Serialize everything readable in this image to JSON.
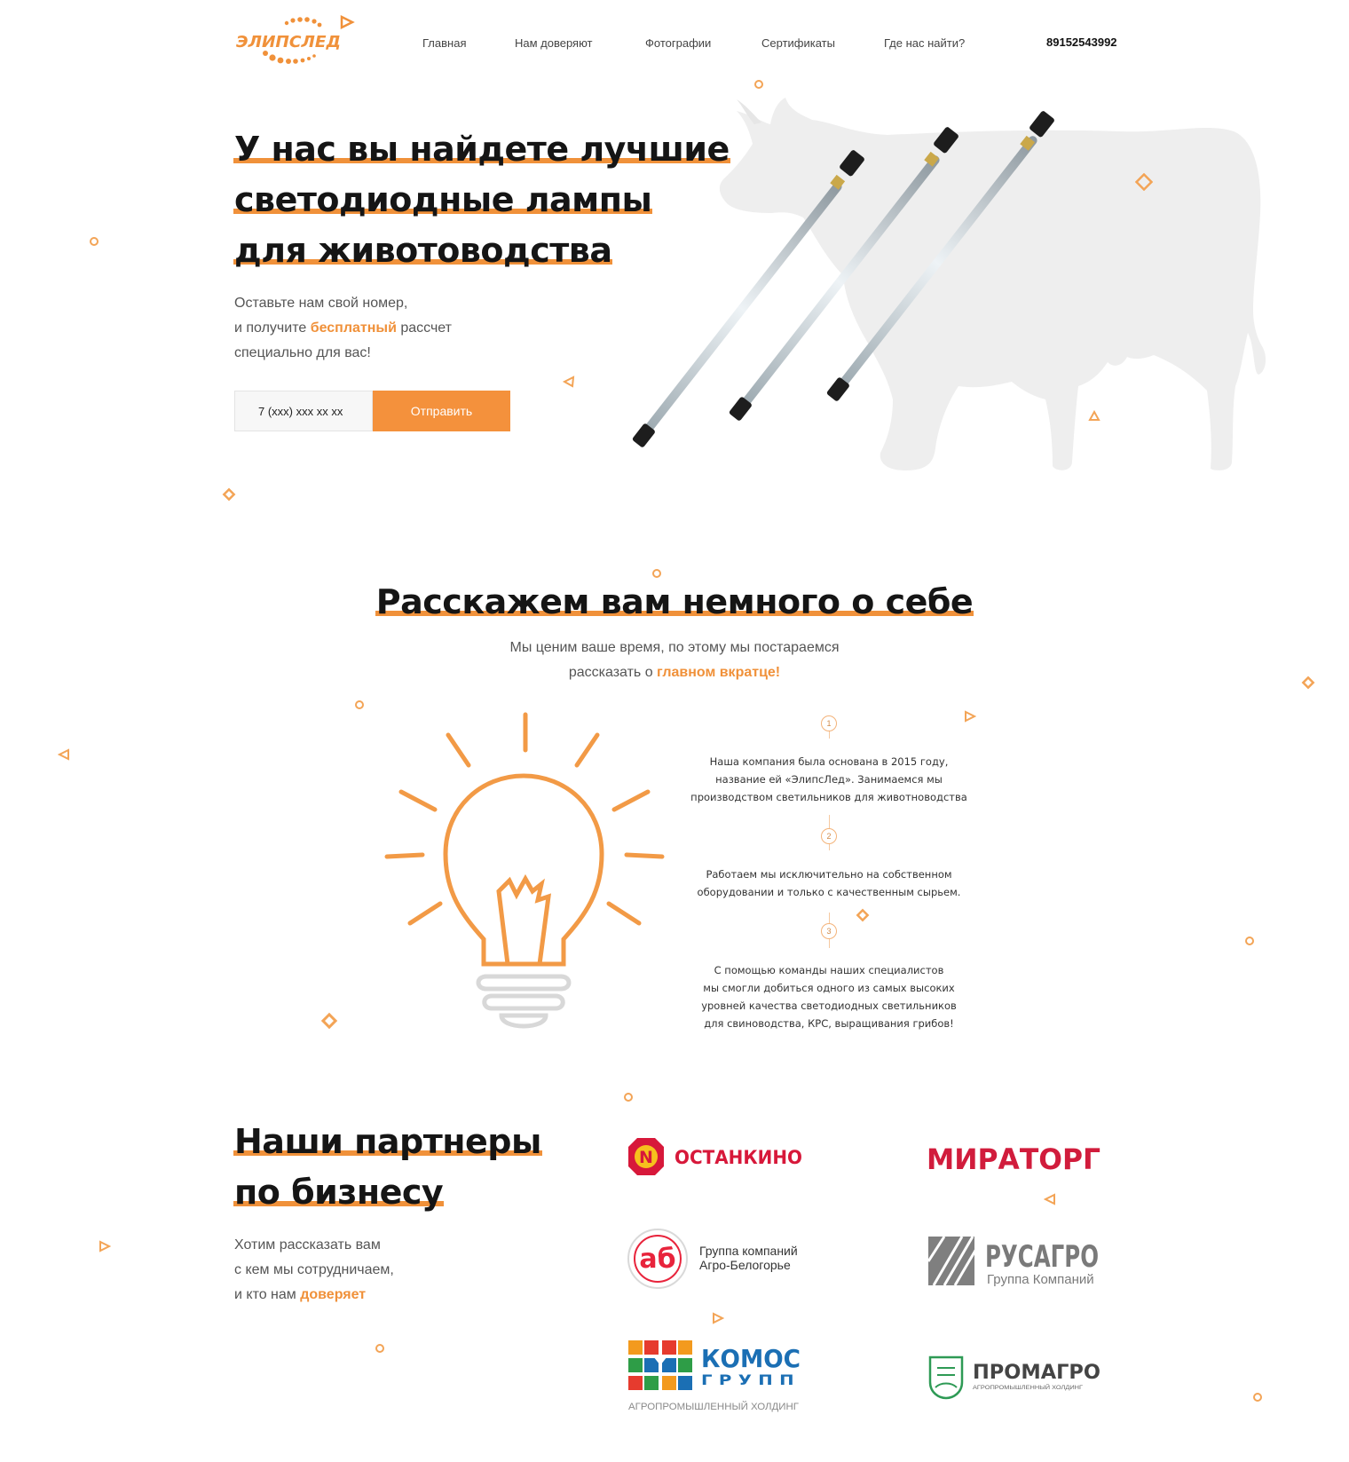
{
  "brand": {
    "logo_text": "ЭЛИПСЛЕД"
  },
  "nav": {
    "items": [
      {
        "label": "Главная"
      },
      {
        "label": "Нам доверяют"
      },
      {
        "label": "Фотографии"
      },
      {
        "label": "Сертификаты"
      },
      {
        "label": "Где нас найти?"
      }
    ],
    "phone": "89152543992"
  },
  "hero": {
    "title_lines": [
      "У нас вы найдете лучшие",
      "светодиодные лампы",
      "для животоводства"
    ],
    "sub_line1": "Оставьте нам свой номер,",
    "sub_line2_pre": "и получите ",
    "sub_line2_accent": "бесплатный",
    "sub_line2_post": " рассчет",
    "sub_line3": "специально для вас!",
    "input_placeholder": "7 (xxx) xxx xx xx",
    "button_label": "Отправить"
  },
  "about": {
    "title": "Расскажем вам немного о себе",
    "sub_line1": "Мы ценим ваше время, по этому мы постараемся",
    "sub_line2_pre": "рассказать о ",
    "sub_line2_accent": "главном вкратце!",
    "steps": [
      {
        "num": "1",
        "lines": [
          "Наша компания была основана в 2015 году,",
          "название ей «ЭлипсЛед». Занимаемся мы",
          "производством светильников для животноводства"
        ]
      },
      {
        "num": "2",
        "lines": [
          "Работаем мы исключительно на собственном",
          "оборудовании и только с качественным сырьем."
        ]
      },
      {
        "num": "3",
        "lines": [
          "С помощью команды наших специалистов",
          "мы смогли добиться одного из самых высоких",
          "уровней качества светодиодных светильников",
          "для свиноводства, КРС, выращивания грибов!"
        ]
      }
    ]
  },
  "partners": {
    "title_lines": [
      "Наши партнеры",
      "по бизнесу"
    ],
    "sub_line1": "Хотим рассказать вам",
    "sub_line2": "с кем мы сотрудничаем,",
    "sub_line3_pre": "и кто нам ",
    "sub_line3_accent": "доверяет",
    "logos": {
      "ostankino": {
        "mark": "N",
        "text": "ОСТАНКИНО"
      },
      "miratorg": {
        "text": "МИРАТОРГ"
      },
      "agro": {
        "mark": "аб",
        "line1": "Группа компаний",
        "line2": "Агро-Белогорье"
      },
      "rusagro": {
        "line1": "РУСАГРО",
        "line2": "Группа Компаний"
      },
      "komos": {
        "line1": "КОМОС",
        "line2": "ГРУПП",
        "line3": "АГРОПРОМЫШЛЕННЫЙ ХОЛДИНГ"
      },
      "promagro": {
        "line1": "ПРОМАГРО",
        "line2": "АГРОПРОМЫШЛЕННЫЙ ХОЛДИНГ"
      }
    }
  },
  "colors": {
    "accent": "#f0913a",
    "button": "#f4913c",
    "heading": "#151515"
  }
}
